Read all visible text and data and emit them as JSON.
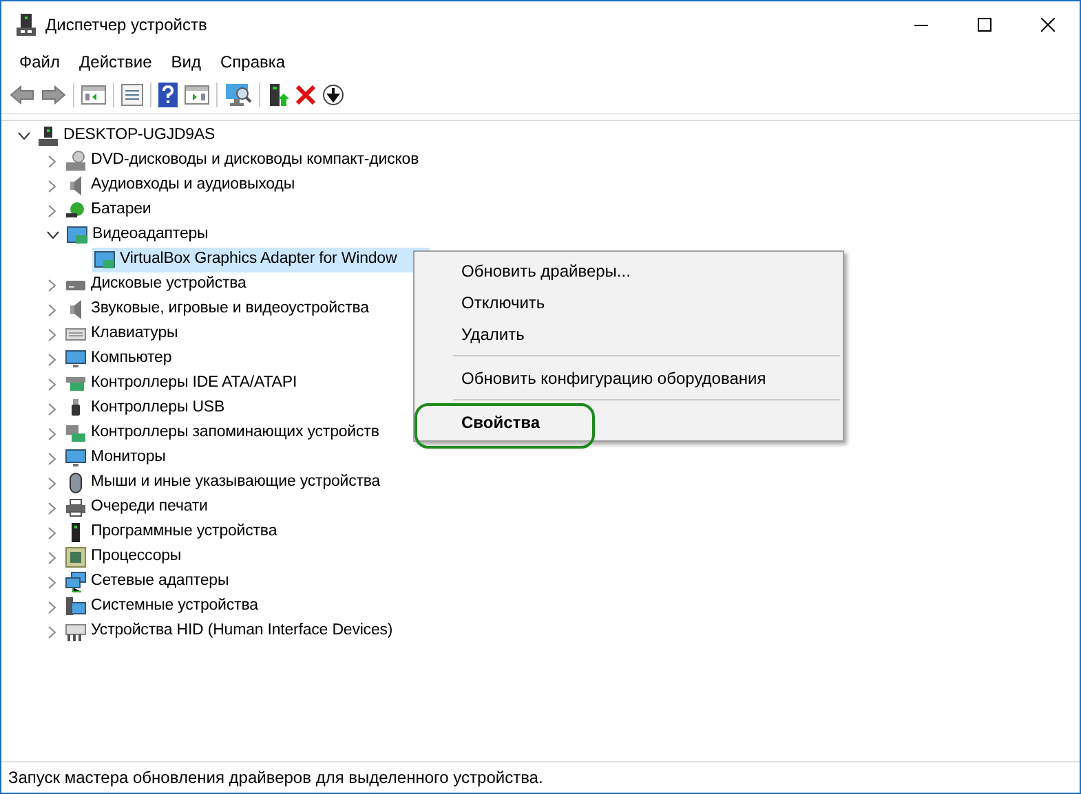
{
  "window": {
    "title": "Диспетчер устройств"
  },
  "menu_bar": [
    "Файл",
    "Действие",
    "Вид",
    "Справка"
  ],
  "tree": {
    "label": "DESKTOP-UGJD9AS",
    "expanded": true,
    "selected": false,
    "children": [
      {
        "label": "DVD-дисководы и дисководы компакт-дисков",
        "expanded": false,
        "selected": false
      },
      {
        "label": "Аудиовходы и аудиовыходы",
        "expanded": false,
        "selected": false
      },
      {
        "label": "Батареи",
        "expanded": false,
        "selected": false
      },
      {
        "label": "Видеоадаптеры",
        "expanded": true,
        "selected": false,
        "children": [
          {
            "label": "VirtualBox Graphics Adapter for Window",
            "selected": true
          }
        ]
      },
      {
        "label": "Дисковые устройства",
        "expanded": false,
        "selected": false
      },
      {
        "label": "Звуковые, игровые и видеоустройства",
        "expanded": false,
        "selected": false
      },
      {
        "label": "Клавиатуры",
        "expanded": false,
        "selected": false
      },
      {
        "label": "Компьютер",
        "expanded": false,
        "selected": false
      },
      {
        "label": "Контроллеры IDE ATA/ATAPI",
        "expanded": false,
        "selected": false
      },
      {
        "label": "Контроллеры USB",
        "expanded": false,
        "selected": false
      },
      {
        "label": "Контроллеры запоминающих устройств",
        "expanded": false,
        "selected": false
      },
      {
        "label": "Мониторы",
        "expanded": false,
        "selected": false
      },
      {
        "label": "Мыши и иные указывающие устройства",
        "expanded": false,
        "selected": false
      },
      {
        "label": "Очереди печати",
        "expanded": false,
        "selected": false
      },
      {
        "label": "Программные устройства",
        "expanded": false,
        "selected": false
      },
      {
        "label": "Процессоры",
        "expanded": false,
        "selected": false
      },
      {
        "label": "Сетевые адаптеры",
        "expanded": false,
        "selected": false
      },
      {
        "label": "Системные устройства",
        "expanded": false,
        "selected": false
      },
      {
        "label": "Устройства HID (Human Interface Devices)",
        "expanded": false,
        "selected": false
      }
    ]
  },
  "context_menu": [
    {
      "kind": "item",
      "label": "Обновить драйверы...",
      "default": false,
      "circled": false
    },
    {
      "kind": "item",
      "label": "Отключить",
      "default": false,
      "circled": false
    },
    {
      "kind": "item",
      "label": "Удалить",
      "default": false,
      "circled": false
    },
    {
      "kind": "separator"
    },
    {
      "kind": "item",
      "label": "Обновить конфигурацию оборудования",
      "default": false,
      "circled": false
    },
    {
      "kind": "separator"
    },
    {
      "kind": "item",
      "label": "Свойства",
      "default": true,
      "circled": true
    }
  ],
  "status_bar": "Запуск мастера обновления драйверов для выделенного устройства."
}
